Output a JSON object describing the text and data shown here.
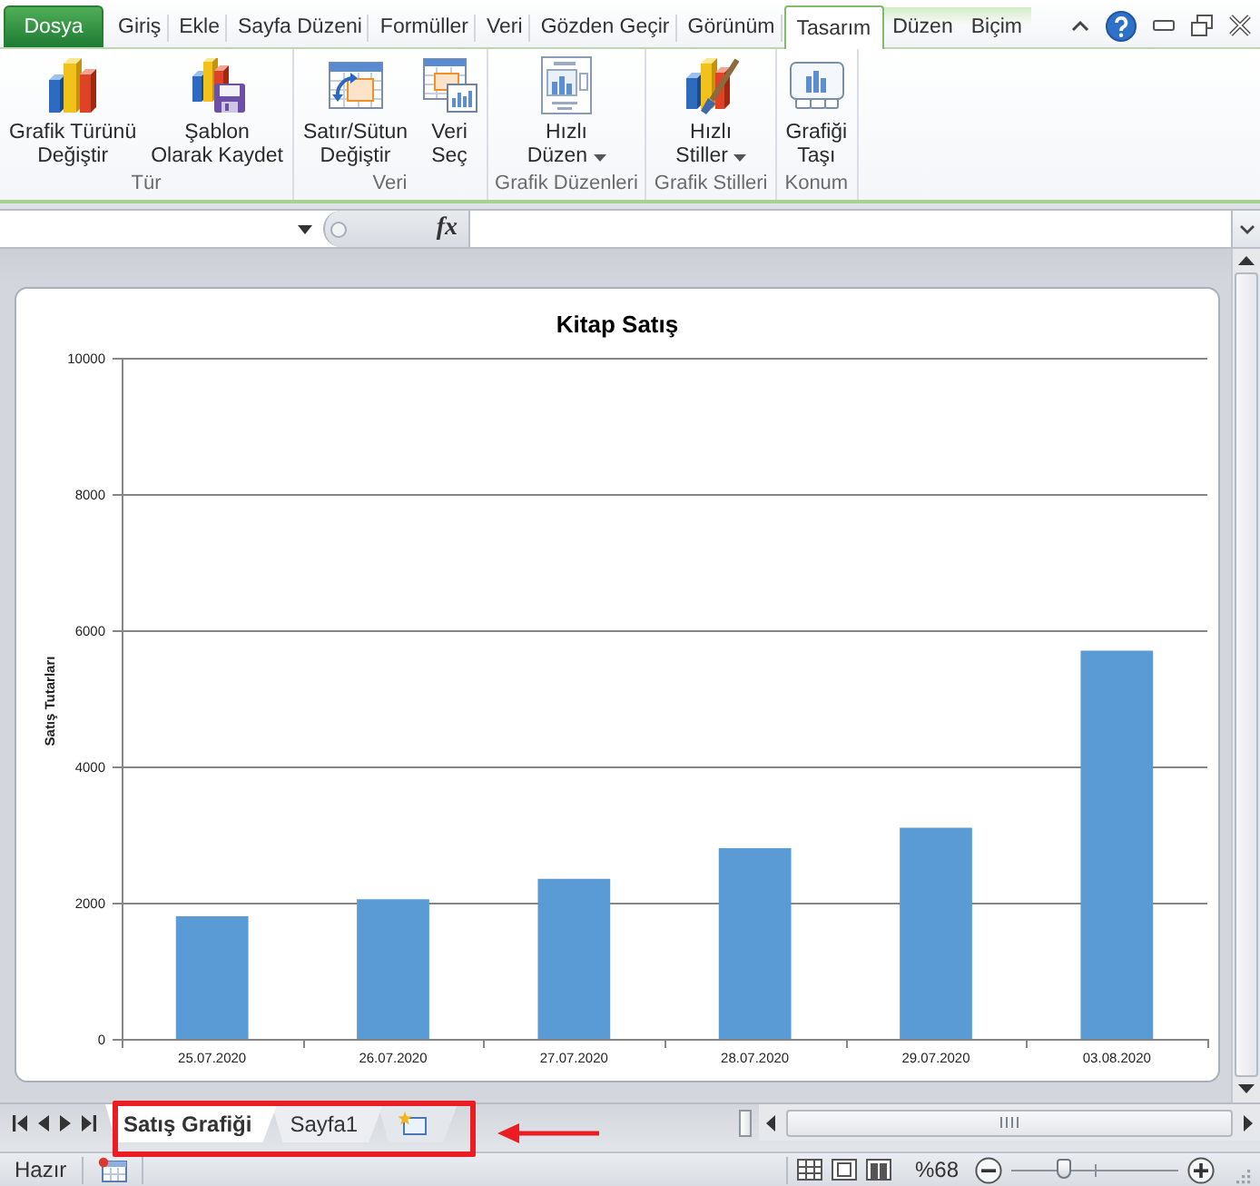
{
  "menu_tabs": [
    {
      "label": "Dosya",
      "kind": "file",
      "selected": false
    },
    {
      "label": "Giriş",
      "kind": "main",
      "selected": false
    },
    {
      "label": "Ekle",
      "kind": "main",
      "selected": false
    },
    {
      "label": "Sayfa Düzeni",
      "kind": "main",
      "selected": false
    },
    {
      "label": "Formüller",
      "kind": "main",
      "selected": false
    },
    {
      "label": "Veri",
      "kind": "main",
      "selected": false
    },
    {
      "label": "Gözden Geçir",
      "kind": "main",
      "selected": false
    },
    {
      "label": "Görünüm",
      "kind": "main",
      "selected": false
    },
    {
      "label": "Tasarım",
      "kind": "contextual",
      "selected": true
    },
    {
      "label": "Düzen",
      "kind": "contextual",
      "selected": false
    },
    {
      "label": "Biçim",
      "kind": "contextual",
      "selected": false
    }
  ],
  "ribbon_groups": [
    {
      "label": "Tür",
      "buttons": [
        {
          "kind": "chart_type",
          "lines": [
            "Grafik Türünü",
            "Değiştir"
          ],
          "dropdown": false
        },
        {
          "kind": "save_template",
          "lines": [
            "Şablon",
            "Olarak Kaydet"
          ],
          "dropdown": false
        }
      ]
    },
    {
      "label": "Veri",
      "buttons": [
        {
          "kind": "switch_row_column",
          "lines": [
            "Satır/Sütun",
            "Değiştir"
          ],
          "dropdown": false
        },
        {
          "kind": "select_data",
          "lines": [
            "Veri",
            "Seç"
          ],
          "dropdown": false
        }
      ]
    },
    {
      "label": "Grafik Düzenleri",
      "buttons": [
        {
          "kind": "quick_layout",
          "lines": [
            "Hızlı",
            "Düzen"
          ],
          "dropdown": true
        }
      ]
    },
    {
      "label": "Grafik Stilleri",
      "buttons": [
        {
          "kind": "quick_styles",
          "lines": [
            "Hızlı",
            "Stiller"
          ],
          "dropdown": true
        }
      ]
    },
    {
      "label": "Konum",
      "buttons": [
        {
          "kind": "move_chart",
          "lines": [
            "Grafiği",
            "Taşı"
          ],
          "dropdown": false
        }
      ]
    }
  ],
  "formula_bar": {
    "function_button": "fx"
  },
  "chart": {
    "chart_data": {
      "type": "bar",
      "title": "Kitap Satış",
      "ylabel": "Satış Tutarları",
      "categories": [
        "25.07.2020",
        "26.07.2020",
        "27.07.2020",
        "28.07.2020",
        "29.07.2020",
        "03.08.2020"
      ],
      "series": [
        {
          "color": "#5b9bd5",
          "values": [
            1800,
            2050,
            2350,
            2800,
            3100,
            5700
          ]
        }
      ],
      "ylim": [
        0,
        10000
      ],
      "yticks": [
        0,
        2000,
        4000,
        6000,
        8000,
        10000
      ],
      "grid": true
    }
  },
  "sheet_tabs": [
    {
      "label": "Satış Grafiği",
      "selected": true
    },
    {
      "label": "Sayfa1",
      "selected": false
    }
  ],
  "status_bar": {
    "status": "Hazır",
    "zoom_label": "%68",
    "zoom_slider": {
      "level": 0.32
    }
  }
}
